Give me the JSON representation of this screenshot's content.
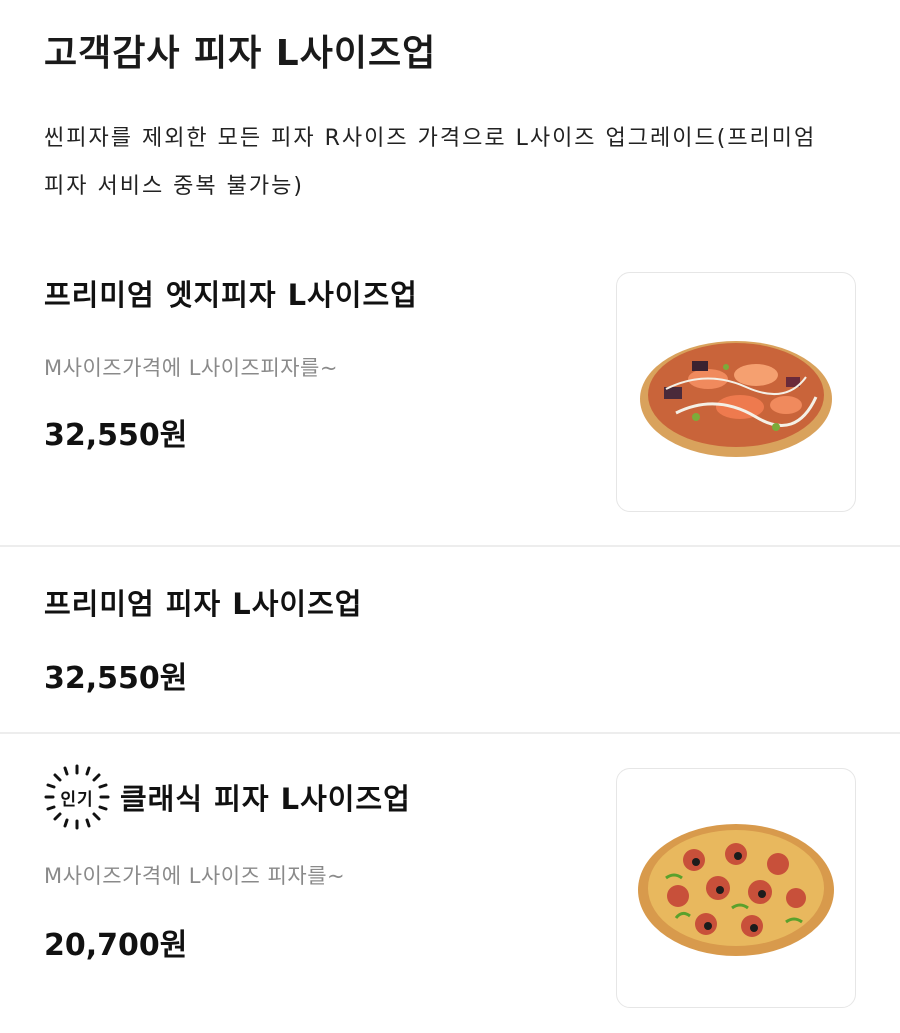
{
  "page": {
    "title": "고객감사 피자 L사이즈업",
    "description": "씬피자를 제외한 모든 피자 R사이즈 가격으로 L사이즈 업그레이드(프리미엄 피자 서비스 중복 불가능)"
  },
  "items": [
    {
      "title": "프리미엄 엣지피자 L사이즈업",
      "subtitle": "M사이즈가격에 L사이즈피자를~",
      "price": "32,550원",
      "image_icon": "seafood-pizza-image"
    },
    {
      "title": "프리미엄 피자 L사이즈업",
      "price": "32,550원"
    },
    {
      "badge": "인기",
      "title": "클래식 피자 L사이즈업",
      "subtitle": "M사이즈가격에 L사이즈 피자를~",
      "price": "20,700원",
      "image_icon": "pepperoni-pizza-image"
    }
  ],
  "colors": {
    "text": "#111111",
    "subtext": "#8a8a8a",
    "divider": "#ededed",
    "card_border": "#e6e6e6"
  }
}
